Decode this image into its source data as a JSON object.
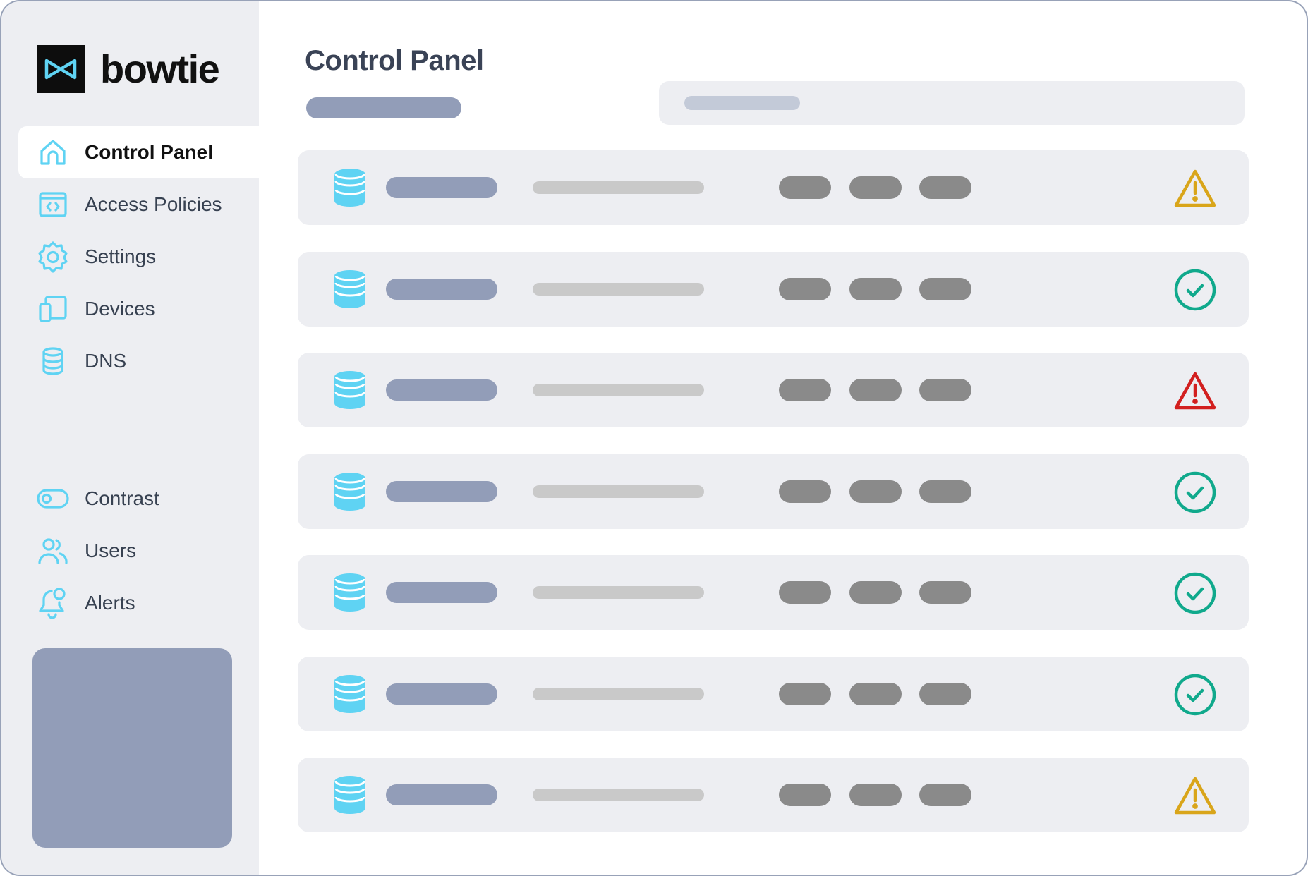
{
  "brand": {
    "name": "bowtie",
    "icon": "bowtie-logo-icon"
  },
  "colors": {
    "accent": "#5fd3f3",
    "warning": "#d9a51a",
    "error": "#d21f1f",
    "success": "#10a98c",
    "placeholder_dark": "#929db8",
    "placeholder_light": "#c9c9c9",
    "tag": "#8a8a8a"
  },
  "sidebar": {
    "items": [
      {
        "label": "Control Panel",
        "icon": "home-icon",
        "active": true
      },
      {
        "label": "Access Policies",
        "icon": "code-window-icon",
        "active": false
      },
      {
        "label": "Settings",
        "icon": "gear-icon",
        "active": false
      },
      {
        "label": "Devices",
        "icon": "devices-icon",
        "active": false
      },
      {
        "label": "DNS",
        "icon": "database-icon",
        "active": false
      }
    ],
    "bottom_items": [
      {
        "label": "Contrast",
        "icon": "toggle-icon"
      },
      {
        "label": "Users",
        "icon": "users-icon"
      },
      {
        "label": "Alerts",
        "icon": "bell-icon"
      }
    ]
  },
  "main": {
    "title": "Control Panel",
    "rows": [
      {
        "icon": "database-icon",
        "status": "warning"
      },
      {
        "icon": "database-icon",
        "status": "success"
      },
      {
        "icon": "database-icon",
        "status": "error"
      },
      {
        "icon": "database-icon",
        "status": "success"
      },
      {
        "icon": "database-icon",
        "status": "success"
      },
      {
        "icon": "database-icon",
        "status": "success"
      },
      {
        "icon": "database-icon",
        "status": "warning"
      }
    ]
  }
}
